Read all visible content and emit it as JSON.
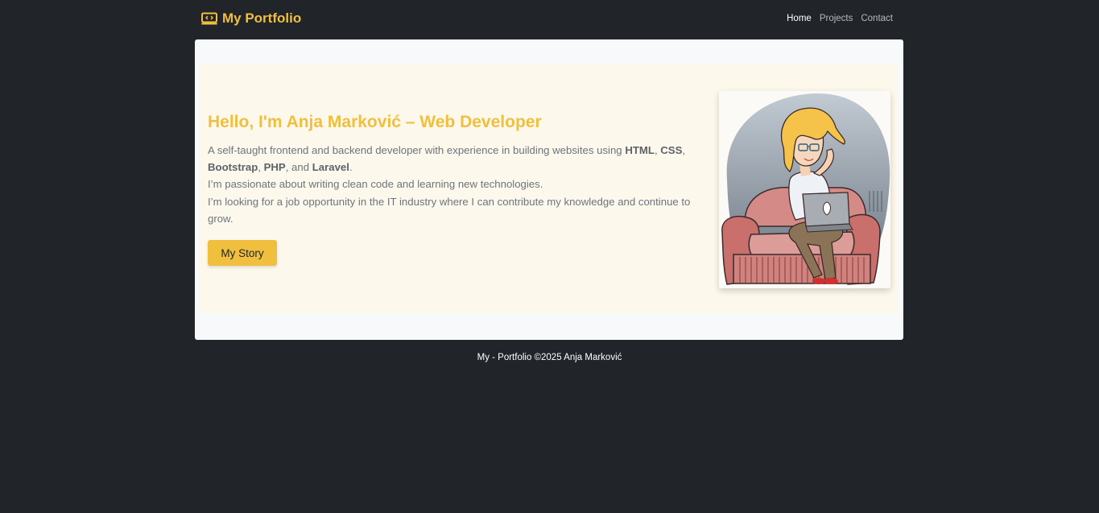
{
  "navbar": {
    "brand": "My Portfolio",
    "brand_icon": "code-icon",
    "links": [
      {
        "label": "Home",
        "active": true
      },
      {
        "label": "Projects",
        "active": false
      },
      {
        "label": "Contact",
        "active": false
      }
    ]
  },
  "hero": {
    "title": "Hello, I'm Anja Marković – Web Developer",
    "intro_prefix": "A self-taught frontend and backend developer with experience in building websites using ",
    "tech": [
      "HTML",
      "CSS",
      "Bootstrap",
      "PHP",
      "Laravel"
    ],
    "sep_comma": ", ",
    "sep_and": ", and ",
    "intro_suffix": ".",
    "line2": "I’m passionate about writing clean code and learning new technologies.",
    "line3": "I’m looking for a job opportunity in the IT industry where I can contribute my knowledge and continue to grow.",
    "button": "My Story",
    "illustration": "developer-illustration"
  },
  "footer": {
    "text": "My - Portfolio ©2025 Anja Marković"
  },
  "colors": {
    "page_bg": "#212529",
    "accent": "#f0bf3e",
    "card_bg": "#f7f9fb",
    "hero_bg": "#fdf8ec",
    "text_muted": "#6c757d"
  }
}
